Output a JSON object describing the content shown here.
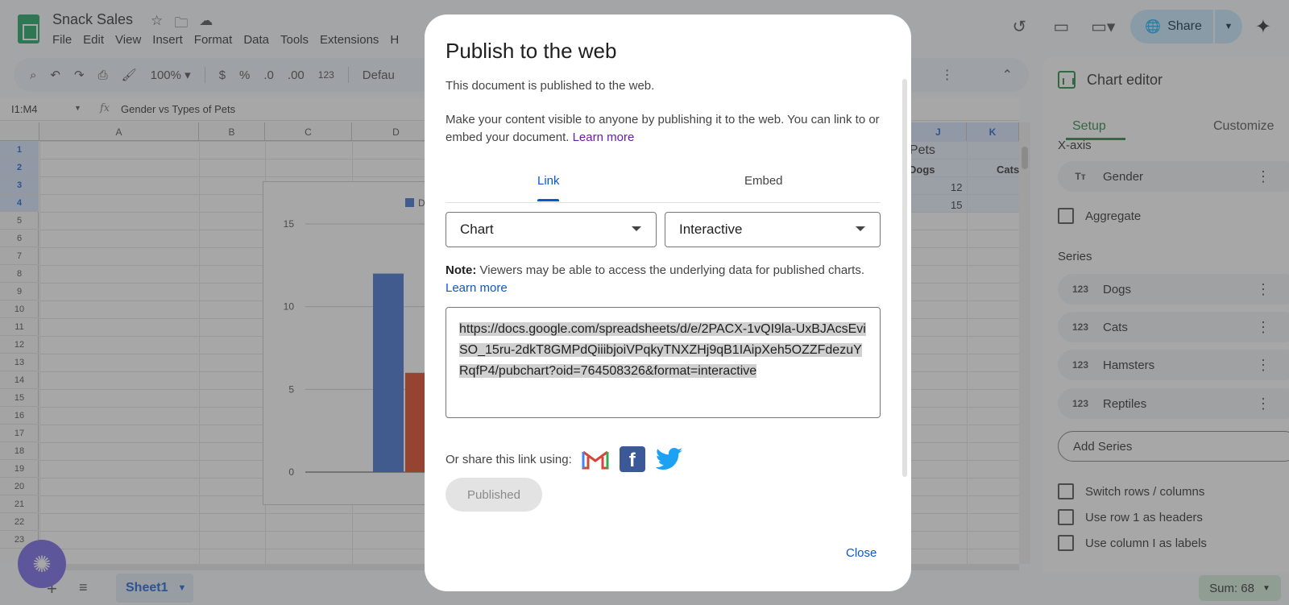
{
  "app": {
    "doc_title": "Snack Sales",
    "menu": [
      "File",
      "Edit",
      "View",
      "Insert",
      "Format",
      "Data",
      "Tools",
      "Extensions",
      "H"
    ],
    "share_label": "Share"
  },
  "toolbar": {
    "zoom": "100%",
    "currency": "$",
    "percent": "%",
    "dec_decrease": ".0",
    "dec_increase": ".00",
    "number_format": "123",
    "font": "Defau"
  },
  "formula_bar": {
    "name_box": "I1:M4",
    "fx": "fx",
    "content": "Gender vs Types of Pets"
  },
  "grid": {
    "columns": [
      "A",
      "B",
      "C",
      "D",
      "J",
      "K"
    ],
    "rows": [
      "1",
      "2",
      "3",
      "4",
      "5",
      "6",
      "7",
      "8",
      "9",
      "10",
      "11",
      "12",
      "13",
      "14",
      "15",
      "16",
      "17",
      "18",
      "19",
      "20",
      "21",
      "22",
      "23"
    ],
    "cells": {
      "title_fragment": "f Pets",
      "dogs_header": "Dogs",
      "cats_header": "Cats",
      "r3_dogs": "12",
      "r4_dogs": "15"
    }
  },
  "chart_data": {
    "type": "bar",
    "yticks": [
      "0",
      "5",
      "10",
      "15"
    ],
    "ylim": [
      0,
      15
    ],
    "legend_fragment": "D",
    "visible_bars": [
      {
        "series": "Dogs",
        "value": 12,
        "color": "#3366cc"
      },
      {
        "series": "Cats",
        "value": 6,
        "color": "#dc3912"
      }
    ]
  },
  "chart_editor": {
    "title": "Chart editor",
    "tabs": [
      "Setup",
      "Customize"
    ],
    "x_axis_label": "X-axis",
    "x_axis_item": {
      "icon": "Tт",
      "label": "Gender"
    },
    "aggregate_label": "Aggregate",
    "series_label": "Series",
    "series": [
      {
        "icon": "123",
        "label": "Dogs"
      },
      {
        "icon": "123",
        "label": "Cats"
      },
      {
        "icon": "123",
        "label": "Hamsters"
      },
      {
        "icon": "123",
        "label": "Reptiles"
      }
    ],
    "add_series_label": "Add Series",
    "options": [
      "Switch rows / columns",
      "Use row 1 as headers",
      "Use column I as labels"
    ]
  },
  "bottom": {
    "sheet_tab": "Sheet1",
    "sum": "Sum: 68"
  },
  "dialog": {
    "title": "Publish to the web",
    "status": "This document is published to the web.",
    "desc": "Make your content visible to anyone by publishing it to the web. You can link to or embed your document.",
    "learn_more": "Learn more",
    "tabs": [
      "Link",
      "Embed"
    ],
    "select_content": "Chart",
    "select_format": "Interactive",
    "note_label": "Note:",
    "note_text": "Viewers may be able to access the underlying data for published charts.",
    "note_link": "Learn more",
    "url": "https://docs.google.com/spreadsheets/d/e/2PACX-1vQI9la-UxBJAcsEviSO_15ru-2dkT8GMPdQiiibjoiVPqkyTNXZHj9qB1IAipXeh5OZZFdezuYRqfP4/pubchart?oid=764508326&format=interactive",
    "share_label": "Or share this link using:",
    "published_label": "Published",
    "close_label": "Close"
  },
  "colors": {
    "accent_blue": "#0b57d0",
    "sheets_green": "#188038",
    "share_bg": "#c2e7ff",
    "sum_bg": "#ceead6"
  }
}
